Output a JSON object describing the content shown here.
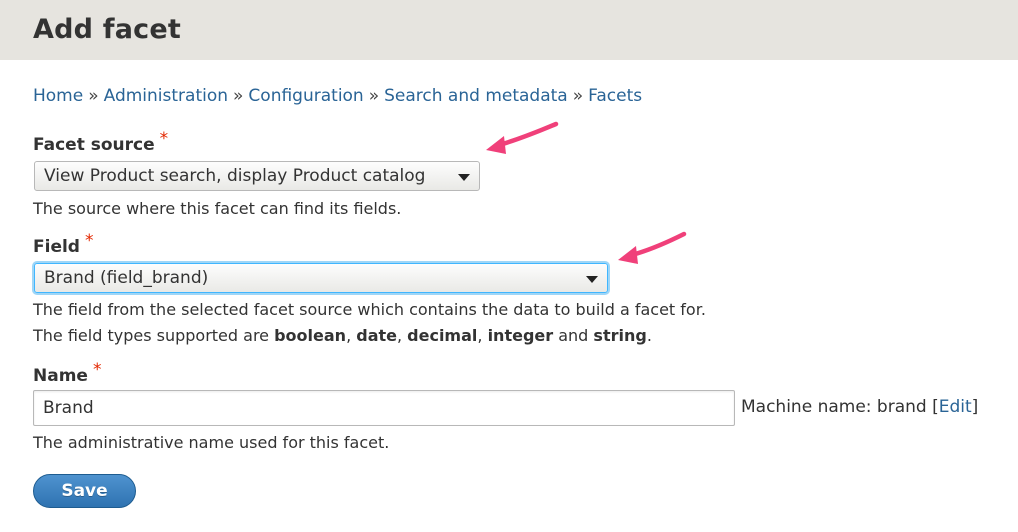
{
  "header": {
    "title": "Add facet"
  },
  "breadcrumb": [
    {
      "label": "Home"
    },
    {
      "label": "Administration"
    },
    {
      "label": "Configuration"
    },
    {
      "label": "Search and metadata"
    },
    {
      "label": "Facets"
    }
  ],
  "breadcrumb_separator": "»",
  "form": {
    "required_marker": "*",
    "facet_source": {
      "label": "Facet source",
      "value": "View Product search, display Product catalog",
      "description": "The source where this facet can find its fields."
    },
    "field": {
      "label": "Field",
      "value": "Brand (field_brand)",
      "description_line1": "The field from the selected facet source which contains the data to build a facet for.",
      "description_line2_prefix": "The field types supported are ",
      "types": [
        "boolean",
        "date",
        "decimal",
        "integer",
        "string"
      ],
      "sep_comma": ", ",
      "sep_and": " and ",
      "end": "."
    },
    "name": {
      "label": "Name",
      "value": "Brand",
      "machine_name_prefix": "Machine name: brand [",
      "machine_name_edit": "Edit",
      "machine_name_suffix": "]",
      "description": "The administrative name used for this facet."
    },
    "save_label": "Save"
  },
  "colors": {
    "header_bg": "#e6e4df",
    "link": "#2a6496",
    "required": "#e32700",
    "button": "#2f73b1",
    "annotation_arrow": "#f0407a",
    "focus_ring": "#40b6ff"
  },
  "icons": {
    "select_caret": "chevron-down-icon",
    "annotation": "pink-arrow-icon"
  }
}
